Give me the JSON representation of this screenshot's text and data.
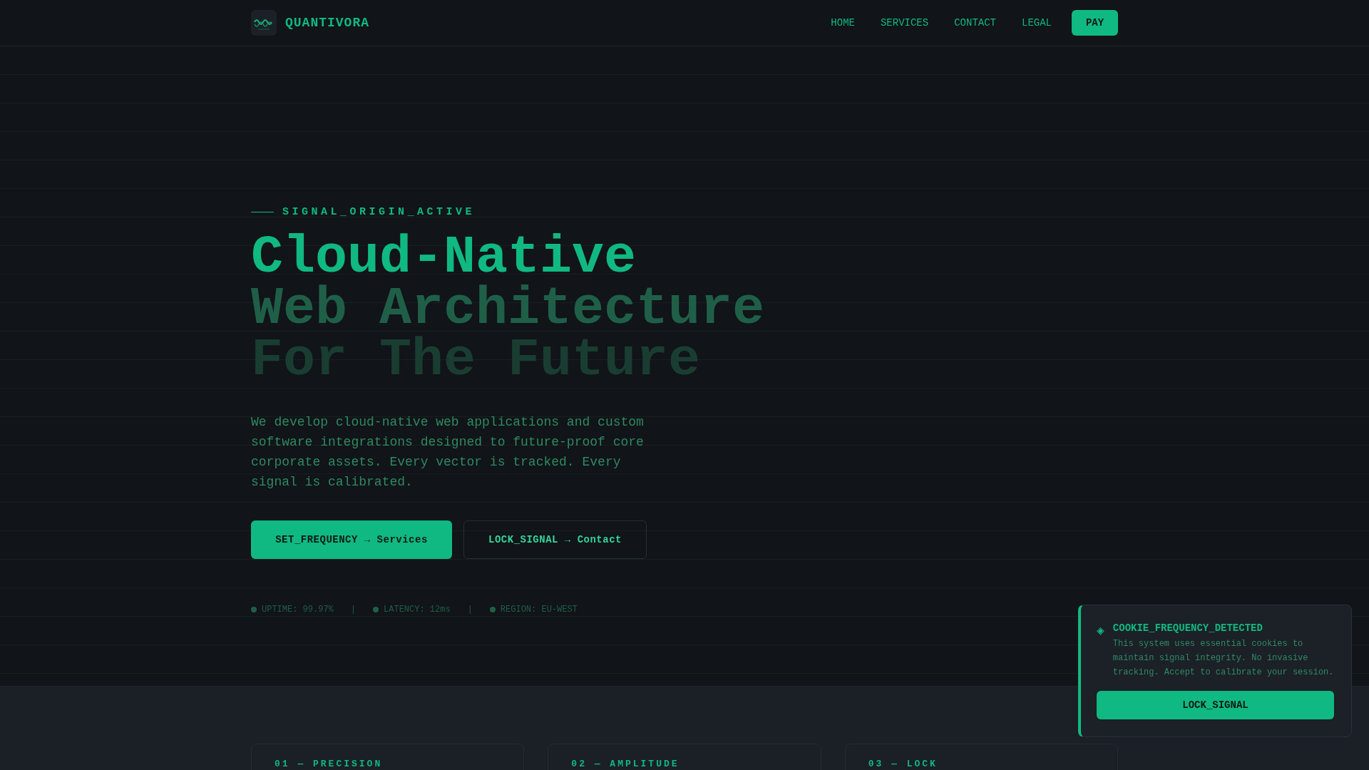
{
  "header": {
    "brand": "QUANTIVORA",
    "nav": [
      {
        "label": "HOME"
      },
      {
        "label": "SERVICES"
      },
      {
        "label": "CONTACT"
      },
      {
        "label": "LEGAL"
      }
    ],
    "pay_button": "PAY"
  },
  "hero": {
    "eyebrow": "SIGNAL_ORIGIN_ACTIVE",
    "title_lines": [
      "Cloud-Native",
      "Web Architecture",
      "For The Future"
    ],
    "description": "We develop cloud-native web applications and custom software integrations designed to future-proof core corporate assets. Every vector is tracked. Every signal is calibrated.",
    "buttons": [
      {
        "kind": "primary",
        "label": "SET_FREQUENCY → Services"
      },
      {
        "kind": "outline",
        "label": "LOCK_SIGNAL → Contact"
      }
    ],
    "stats": [
      {
        "label": "UPTIME: 99.97%"
      },
      {
        "label": "LATENCY: 12ms"
      },
      {
        "label": "REGION: EU-WEST"
      }
    ],
    "stat_separator": "|"
  },
  "cards": [
    {
      "label": "01 — PRECISION"
    },
    {
      "label": "02 — AMPLITUDE"
    },
    {
      "label": "03 — LOCK"
    }
  ],
  "cookie_banner": {
    "icon": "◈",
    "title": "COOKIE_FREQUENCY_DETECTED",
    "text": "This system uses essential cookies to maintain signal integrity. No invasive tracking. Accept to calibrate your session.",
    "button": "LOCK_SIGNAL"
  }
}
